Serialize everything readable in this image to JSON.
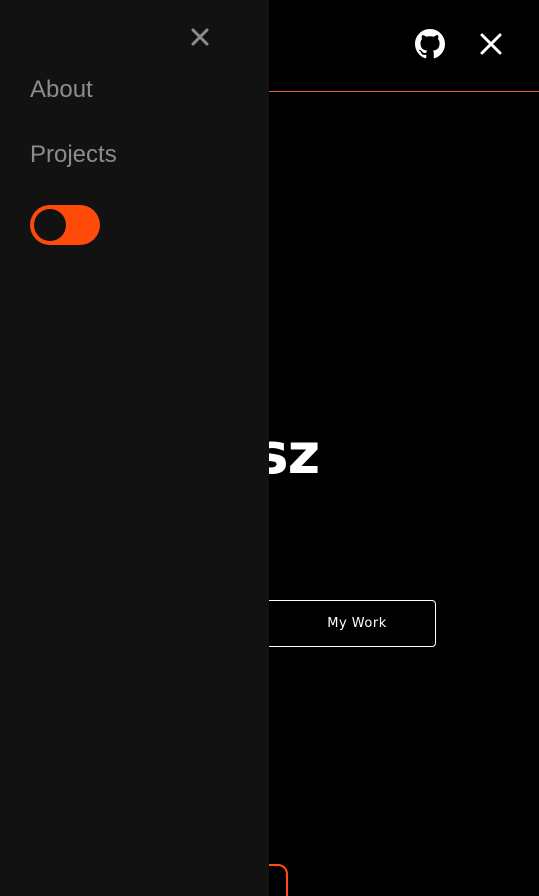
{
  "colors": {
    "background": "#000000",
    "drawer_background": "#121212",
    "accent": "#ff4a0a",
    "header_line": "#e8553a",
    "nav_text": "#8c8c8c",
    "text": "#ffffff"
  },
  "header": {
    "github_icon": "github-icon",
    "close_icon": "close-icon"
  },
  "hero": {
    "name_visible": "liusz",
    "button_label": "My Work"
  },
  "drawer": {
    "close_icon": "close-icon",
    "nav": [
      {
        "label": "About"
      },
      {
        "label": "Projects"
      }
    ],
    "theme_toggle": {
      "on": true
    }
  }
}
